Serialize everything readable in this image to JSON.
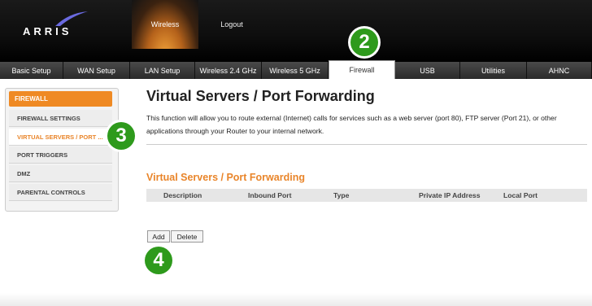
{
  "header": {
    "brand": "ARRIS",
    "nav": {
      "wireless": "Wireless",
      "logout": "Logout"
    }
  },
  "tabs": [
    "Basic Setup",
    "WAN Setup",
    "LAN Setup",
    "Wireless 2.4 GHz",
    "Wireless 5 GHz",
    "Firewall",
    "USB",
    "Utilities",
    "AHNC"
  ],
  "active_tab": "Firewall",
  "sidebar": {
    "header": "FIREWALL",
    "items": [
      "FIREWALL SETTINGS",
      "VIRTUAL SERVERS / PORT ...",
      "PORT TRIGGERS",
      "DMZ",
      "PARENTAL CONTROLS"
    ],
    "active_item": "VIRTUAL SERVERS / PORT ..."
  },
  "main": {
    "title": "Virtual Servers / Port Forwarding",
    "description": "This function will allow you to route external (Internet) calls for services such as a web server (port 80), FTP server (Port 21), or other applications through your Router to your internal network.",
    "section_title": "Virtual Servers / Port Forwarding",
    "columns": [
      "Description",
      "Inbound Port",
      "Type",
      "Private IP Address",
      "Local Port"
    ],
    "buttons": {
      "add": "Add",
      "delete": "Delete"
    }
  },
  "step_badges": [
    "2",
    "3",
    "4"
  ],
  "colors": {
    "accent": "#ef8a24",
    "badge": "#2e9a1c",
    "header_bg": "#0d0d0d"
  }
}
